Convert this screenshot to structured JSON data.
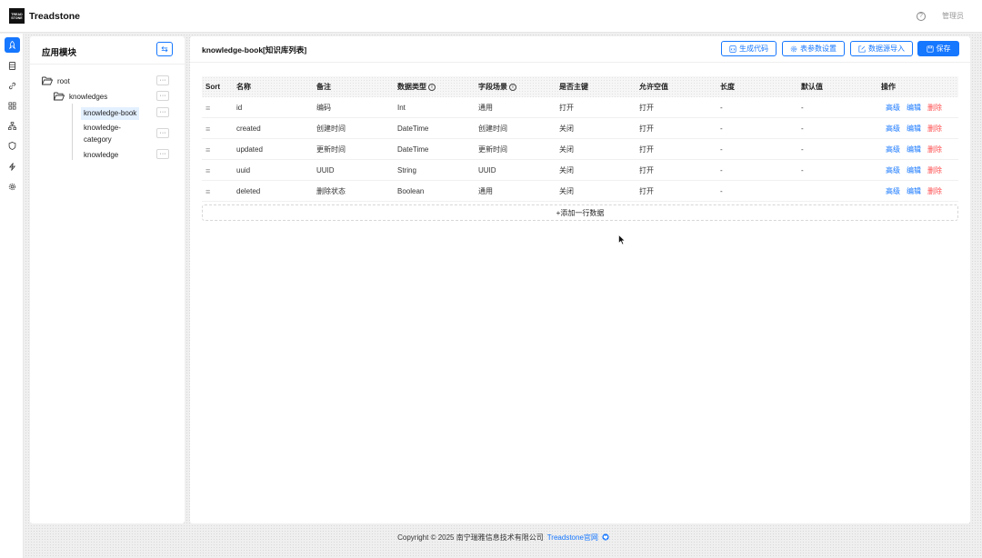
{
  "app": {
    "logo_line1": "TREAD",
    "logo_line2": "STONE",
    "title": "Treadstone",
    "help_icon": "question-circle-icon",
    "user": "管理员"
  },
  "rail": {
    "items": [
      {
        "name": "rocket-icon",
        "active": true
      },
      {
        "name": "database-icon",
        "active": false
      },
      {
        "name": "link-icon",
        "active": false
      },
      {
        "name": "apps-icon",
        "active": false
      },
      {
        "name": "sitemap-icon",
        "active": false
      },
      {
        "name": "shield-icon",
        "active": false
      },
      {
        "name": "lightning-icon",
        "active": false
      },
      {
        "name": "gear-icon",
        "active": false
      }
    ]
  },
  "module_panel": {
    "title": "应用模块",
    "swap_icon": "swap-icon",
    "tree": {
      "root": "root",
      "folder": "knowledges",
      "leaves": [
        "knowledge-book",
        "knowledge-category",
        "knowledge"
      ],
      "leaf_category_line1": "knowledge-",
      "leaf_category_line2": "category",
      "more": "···"
    }
  },
  "table_panel": {
    "title": "knowledge-book[知识库列表]",
    "buttons": {
      "generate": "生成代码",
      "table_params": "表参数设置",
      "import": "数据源导入",
      "save": "保存"
    },
    "columns": [
      "Sort",
      "名称",
      "备注",
      "数据类型",
      "字段场景",
      "是否主键",
      "允许空值",
      "长度",
      "默认值",
      "操作"
    ],
    "rows": [
      {
        "name": "id",
        "remark": "编码",
        "type": "Int",
        "scene": "通用",
        "pk": "打开",
        "nullable": "打开",
        "length": "-",
        "default": "-"
      },
      {
        "name": "created",
        "remark": "创建时间",
        "type": "DateTime",
        "scene": "创建时间",
        "pk": "关闭",
        "nullable": "打开",
        "length": "-",
        "default": "-"
      },
      {
        "name": "updated",
        "remark": "更新时间",
        "type": "DateTime",
        "scene": "更新时间",
        "pk": "关闭",
        "nullable": "打开",
        "length": "-",
        "default": "-"
      },
      {
        "name": "uuid",
        "remark": "UUID",
        "type": "String",
        "scene": "UUID",
        "pk": "关闭",
        "nullable": "打开",
        "length": "-",
        "default": "-"
      },
      {
        "name": "deleted",
        "remark": "删除状态",
        "type": "Boolean",
        "scene": "通用",
        "pk": "关闭",
        "nullable": "打开",
        "length": "-",
        "default": ""
      }
    ],
    "row_actions": {
      "advanced": "高级",
      "edit": "编辑",
      "delete": "删除"
    },
    "add_row": "+添加一行数据"
  },
  "footer": {
    "copyright": "Copyright © 2025 南宁瑞雅信息技术有限公司",
    "site_link": "Treadstone官网",
    "github_icon": "github-icon"
  },
  "colors": {
    "accent": "#1677ff",
    "danger": "#ff4d4f",
    "selected_bg": "#e3f0ff"
  }
}
